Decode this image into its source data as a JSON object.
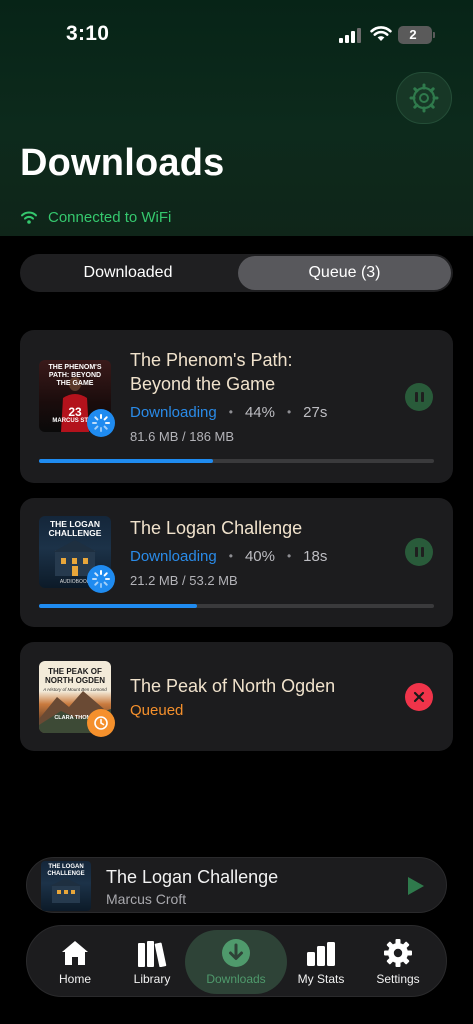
{
  "status_bar": {
    "time": "3:10",
    "battery": "2"
  },
  "header": {
    "title": "Downloads",
    "connection": "Connected to WiFi",
    "settings_icon": "gear-icon"
  },
  "segments": [
    {
      "label": "Downloaded",
      "selected": false
    },
    {
      "label": "Queue (3)",
      "selected": true
    }
  ],
  "queue": [
    {
      "title_line1": "The Phenom's Path:",
      "title_line2": "Beyond the Game",
      "status": "Downloading",
      "percent": "44%",
      "eta": "27s",
      "size": "81.6 MB / 186 MB",
      "progress": 0.44,
      "cover_text": "THE PHENOM'S PATH: BEYOND THE GAME",
      "cover_author": "MARCUS STO..."
    },
    {
      "title": "The Logan Challenge",
      "status": "Downloading",
      "percent": "40%",
      "eta": "18s",
      "size": "21.2 MB / 53.2 MB",
      "progress": 0.4,
      "cover_text": "THE LOGAN CHALLENGE",
      "cover_footer": "AUDIOBOOK"
    },
    {
      "title": "The Peak of North Ogden",
      "status": "Queued",
      "cover_text": "THE PEAK OF NORTH OGDEN",
      "cover_sub": "A History of Mount Ben Lomond",
      "cover_author": "CLARA THOM..."
    }
  ],
  "mini_player": {
    "title": "The Logan Challenge",
    "author": "Marcus Croft",
    "cover_text": "THE LOGAN CHALLENGE"
  },
  "tabs": [
    {
      "label": "Home",
      "icon": "house-icon"
    },
    {
      "label": "Library",
      "icon": "books-icon"
    },
    {
      "label": "Downloads",
      "icon": "download-icon",
      "active": true
    },
    {
      "label": "My Stats",
      "icon": "bar-chart-icon"
    },
    {
      "label": "Settings",
      "icon": "gear-icon"
    }
  ],
  "colors": {
    "accent_green": "#35c86e",
    "download_blue": "#1f8bf0",
    "queued_orange": "#f5902c",
    "cancel_red": "#f0344a",
    "title_cream": "#f0e2cc"
  }
}
